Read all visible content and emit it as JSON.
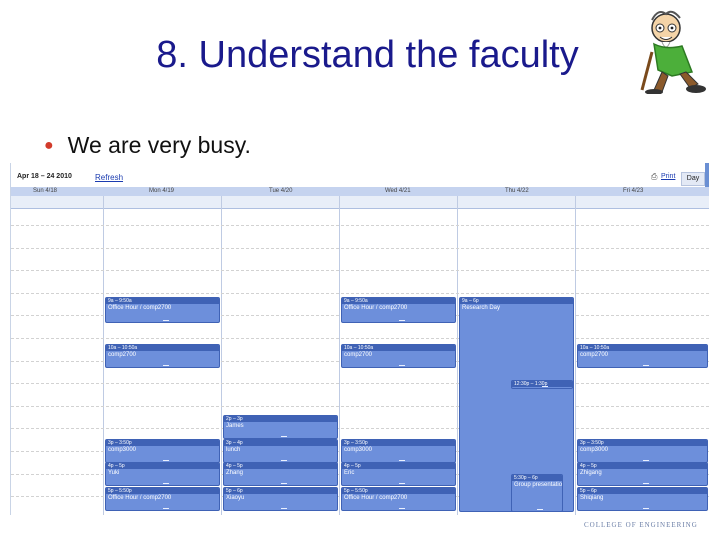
{
  "slide": {
    "title": "8. Understand the faculty",
    "bullet": "We are very busy."
  },
  "calendar": {
    "date_range": "Apr 18 – 24 2010",
    "refresh_label": "Refresh",
    "print_label": "Print",
    "view_tab": "Day",
    "days": [
      {
        "label": "Sun 4/18"
      },
      {
        "label": "Mon 4/19"
      },
      {
        "label": "Tue 4/20"
      },
      {
        "label": "Wed 4/21"
      },
      {
        "label": "Thu 4/22"
      },
      {
        "label": "Fri 4/23"
      }
    ],
    "events": [
      {
        "day": 1,
        "time": "9a – 9:50a",
        "title": "Office Hour / comp2700"
      },
      {
        "day": 3,
        "time": "9a – 9:50a",
        "title": "Office Hour / comp2700"
      },
      {
        "day": 4,
        "time": "9a – 6p",
        "title": "Research Day"
      },
      {
        "day": 1,
        "time": "10a – 10:50a",
        "title": "comp2700"
      },
      {
        "day": 3,
        "time": "10a – 10:50a",
        "title": "comp2700"
      },
      {
        "day": 5,
        "time": "10a – 10:50a",
        "title": "comp2700"
      },
      {
        "day": 4,
        "time": "12:30p – 1:30p",
        "title": ""
      },
      {
        "day": 2,
        "time": "2p – 3p",
        "title": "James"
      },
      {
        "day": 1,
        "time": "3p – 3:50p",
        "title": "comp3000"
      },
      {
        "day": 2,
        "time": "3p – 4p",
        "title": "lunch"
      },
      {
        "day": 3,
        "time": "3p – 3:50p",
        "title": "comp3000"
      },
      {
        "day": 5,
        "time": "3p – 3:50p",
        "title": "comp3000"
      },
      {
        "day": 1,
        "time": "4p – 5p",
        "title": "Yuki"
      },
      {
        "day": 2,
        "time": "4p – 5p",
        "title": "Zhang"
      },
      {
        "day": 3,
        "time": "4p – 5p",
        "title": "Eric"
      },
      {
        "day": 5,
        "time": "4p – 5p",
        "title": "Zhigang"
      },
      {
        "day": 4,
        "time": "5:30p – 6p",
        "title": "Group presentation"
      },
      {
        "day": 1,
        "time": "5p – 5:50p",
        "title": "Office Hour / comp2700"
      },
      {
        "day": 2,
        "time": "5p – 6p",
        "title": "Xiaoyu"
      },
      {
        "day": 3,
        "time": "5p – 5:50p",
        "title": "Office Hour / comp2700"
      },
      {
        "day": 5,
        "time": "5p – 6p",
        "title": "Shiqiang"
      }
    ]
  },
  "footer": {
    "logo_text": "COLLEGE OF ENGINEERING"
  },
  "colors": {
    "title": "#1a1a8c",
    "bullet": "#d23b2b",
    "event_fill": "#6d8fdb",
    "event_border": "#3f62b5",
    "header_bar": "#c5d3ef"
  }
}
